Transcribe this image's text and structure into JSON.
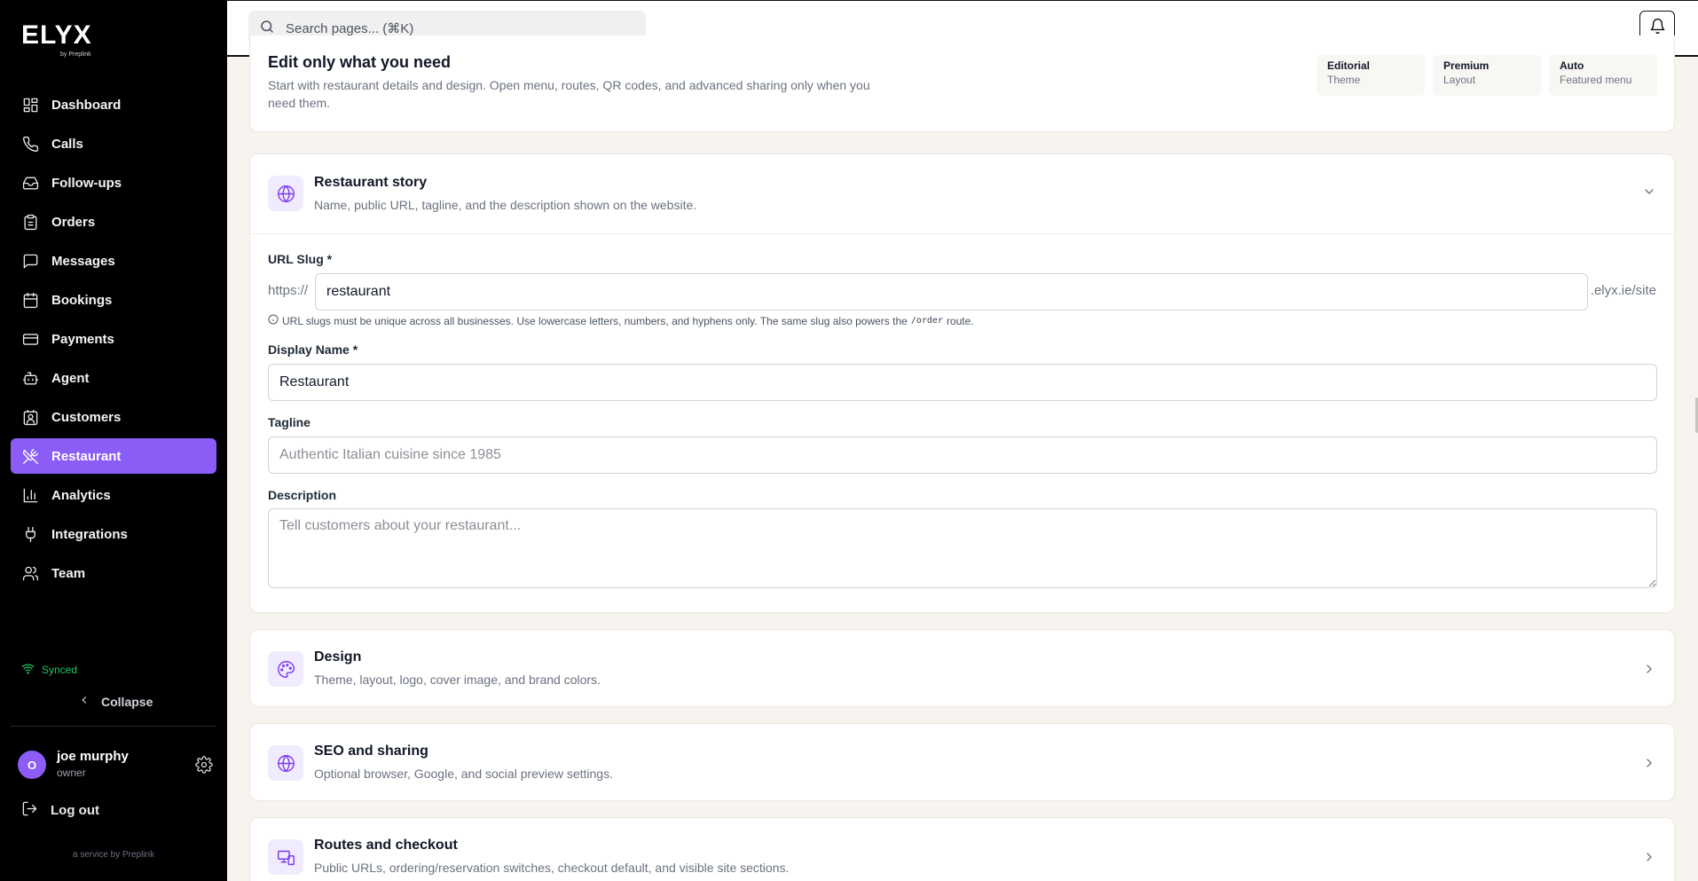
{
  "brand": {
    "name": "ELYX",
    "sub": "by Preplink"
  },
  "nav": [
    {
      "label": "Dashboard",
      "icon": "dashboard-icon"
    },
    {
      "label": "Calls",
      "icon": "phone-icon"
    },
    {
      "label": "Follow-ups",
      "icon": "inbox-icon"
    },
    {
      "label": "Orders",
      "icon": "clipboard-icon"
    },
    {
      "label": "Messages",
      "icon": "message-icon"
    },
    {
      "label": "Bookings",
      "icon": "calendar-icon"
    },
    {
      "label": "Payments",
      "icon": "credit-card-icon"
    },
    {
      "label": "Agent",
      "icon": "bot-icon"
    },
    {
      "label": "Customers",
      "icon": "contact-icon"
    },
    {
      "label": "Restaurant",
      "icon": "utensils-icon",
      "active": true
    },
    {
      "label": "Analytics",
      "icon": "bar-chart-icon"
    },
    {
      "label": "Integrations",
      "icon": "plug-icon"
    },
    {
      "label": "Team",
      "icon": "users-icon"
    }
  ],
  "sidebar_footer": {
    "synced": "Synced",
    "collapse": "Collapse",
    "user_initial": "O",
    "user_name": "joe murphy",
    "user_role": "owner",
    "logout": "Log out",
    "service": "a service by Preplink"
  },
  "topbar": {
    "search_placeholder": "Search pages... (⌘K)"
  },
  "intro": {
    "title": "Edit only what you need",
    "description": "Start with restaurant details and design. Open menu, routes, QR codes, and advanced sharing only when you need them.",
    "stats": [
      {
        "value": "Editorial",
        "label": "Theme"
      },
      {
        "value": "Premium",
        "label": "Layout"
      },
      {
        "value": "Auto",
        "label": "Featured menu"
      }
    ]
  },
  "story": {
    "title": "Restaurant story",
    "description": "Name, public URL, tagline, and the description shown on the website.",
    "url_slug": {
      "label": "URL Slug *",
      "prefix": "https://",
      "value": "restaurant",
      "suffix": ".elyx.ie/site",
      "hint_before": "URL slugs must be unique across all businesses. Use lowercase letters, numbers, and hyphens only. The same slug also powers the",
      "hint_code": "/order",
      "hint_after": "route."
    },
    "display_name": {
      "label": "Display Name *",
      "value": "Restaurant"
    },
    "tagline": {
      "label": "Tagline",
      "placeholder": "Authentic Italian cuisine since 1985"
    },
    "description_field": {
      "label": "Description",
      "placeholder": "Tell customers about your restaurant..."
    }
  },
  "sections": [
    {
      "title": "Design",
      "description": "Theme, layout, logo, cover image, and brand colors.",
      "icon": "palette-icon"
    },
    {
      "title": "SEO and sharing",
      "description": "Optional browser, Google, and social preview settings.",
      "icon": "globe-icon"
    },
    {
      "title": "Routes and checkout",
      "description": "Public URLs, ordering/reservation switches, checkout default, and visible site sections.",
      "icon": "devices-icon"
    }
  ]
}
